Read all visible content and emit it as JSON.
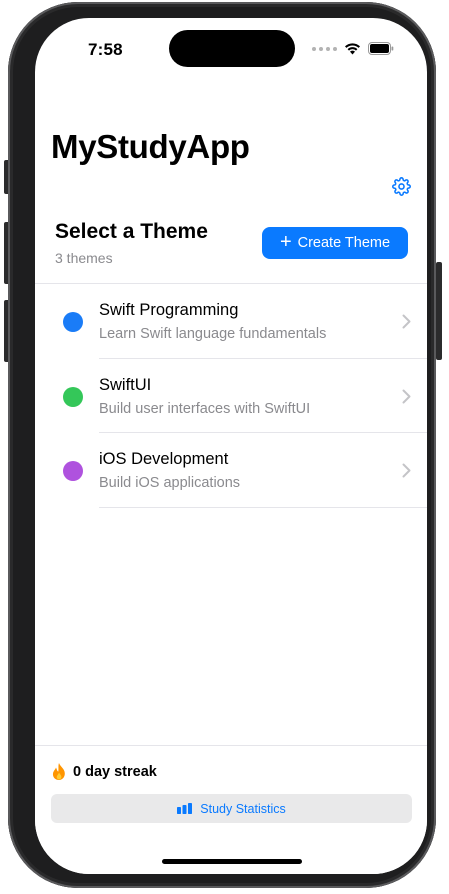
{
  "status_bar": {
    "time": "7:58"
  },
  "header": {
    "app_title": "MyStudyApp",
    "settings_icon": "gear-icon"
  },
  "theme_section": {
    "title": "Select a Theme",
    "count": "3 themes",
    "create_button_label": "Create Theme",
    "create_button_icon": "plus-icon"
  },
  "themes": [
    {
      "name": "Swift Programming",
      "description": "Learn Swift language fundamentals",
      "color": "#1a7cf7"
    },
    {
      "name": "SwiftUI",
      "description": "Build user interfaces with SwiftUI",
      "color": "#34c759"
    },
    {
      "name": "iOS Development",
      "description": "Build iOS applications",
      "color": "#af52de"
    }
  ],
  "footer": {
    "streak_text": "0 day streak",
    "streak_icon": "flame-icon",
    "stats_button_label": "Study Statistics",
    "stats_button_icon": "bar-chart-icon"
  },
  "colors": {
    "accent": "#0a7aff",
    "secondary_text": "#8a8a8e",
    "flame": "#ff9500"
  }
}
